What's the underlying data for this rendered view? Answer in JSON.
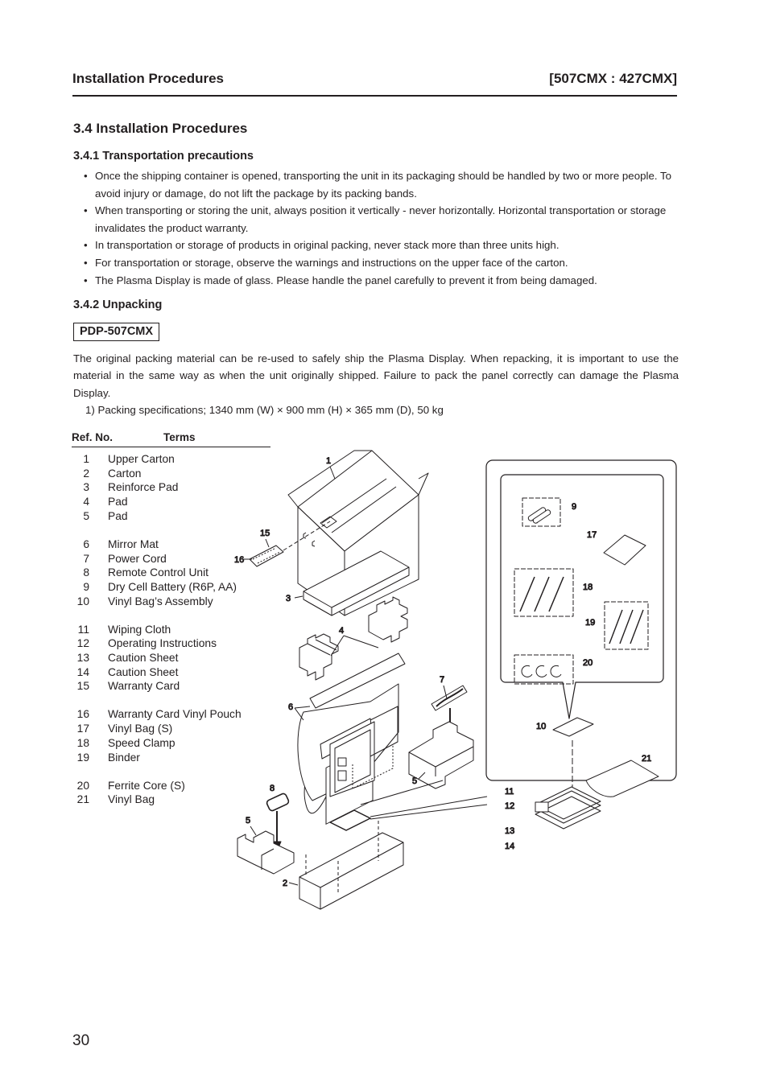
{
  "header": {
    "title": "Installation Procedures",
    "model": "[507CMX : 427CMX]"
  },
  "section": {
    "title": "3.4 Installation Procedures",
    "transportation": {
      "title": "3.4.1 Transportation precautions",
      "bullets": [
        "Once the shipping container is opened, transporting the unit in its packaging should be handled by two or more people. To avoid injury or damage, do not lift the package by its packing bands.",
        "When transporting or storing the unit, always position it vertically - never horizontally. Horizontal transportation or storage invalidates the product warranty.",
        "In transportation or storage of products in original packing, never stack more than three units high.",
        "For transportation or storage, observe the warnings and instructions on the upper face of the carton.",
        "The Plasma Display is made of glass. Please handle the panel carefully to prevent it from being damaged."
      ]
    },
    "unpacking": {
      "title": "3.4.2 Unpacking",
      "model_label": "PDP-507CMX",
      "paragraph": "The original packing material can be re-used to safely ship the Plasma Display. When repacking, it is important to use the material in the same way as when the unit originally shipped. Failure to pack the panel correctly can damage the Plasma Display.",
      "spec": "1)  Packing specifications; 1340 mm (W) × 900 mm (H) × 365 mm (D), 50 kg",
      "table": {
        "col_ref": "Ref. No.",
        "col_terms": "Terms",
        "rows": [
          {
            "ref": "1",
            "term": "Upper Carton"
          },
          {
            "ref": "2",
            "term": "Carton"
          },
          {
            "ref": "3",
            "term": "Reinforce Pad"
          },
          {
            "ref": "4",
            "term": "Pad"
          },
          {
            "ref": "5",
            "term": "Pad"
          },
          {
            "ref": "6",
            "term": "Mirror Mat"
          },
          {
            "ref": "7",
            "term": "Power Cord"
          },
          {
            "ref": "8",
            "term": "Remote Control Unit"
          },
          {
            "ref": "9",
            "term": "Dry Cell Battery (R6P, AA)"
          },
          {
            "ref": "10",
            "term": "Vinyl Bag’s Assembly"
          },
          {
            "ref": "11",
            "term": "Wiping Cloth"
          },
          {
            "ref": "12",
            "term": "Operating Instructions"
          },
          {
            "ref": "13",
            "term": "Caution Sheet"
          },
          {
            "ref": "14",
            "term": "Caution Sheet"
          },
          {
            "ref": "15",
            "term": "Warranty Card"
          },
          {
            "ref": "16",
            "term": "Warranty Card Vinyl Pouch"
          },
          {
            "ref": "17",
            "term": "Vinyl Bag (S)"
          },
          {
            "ref": "18",
            "term": "Speed Clamp"
          },
          {
            "ref": "19",
            "term": "Binder"
          },
          {
            "ref": "20",
            "term": "Ferrite Core (S)"
          },
          {
            "ref": "21",
            "term": "Vinyl Bag"
          }
        ]
      }
    }
  },
  "diagram": {
    "callouts": {
      "c1": "1",
      "c2": "2",
      "c3": "3",
      "c4": "4",
      "c5a": "5",
      "c5b": "5",
      "c6": "6",
      "c7": "7",
      "c8": "8",
      "c9": "9",
      "c10": "10",
      "c11": "11",
      "c12": "12",
      "c13": "13",
      "c14": "14",
      "c15": "15",
      "c16": "16",
      "c17": "17",
      "c18": "18",
      "c19": "19",
      "c20": "20",
      "c21": "21"
    }
  },
  "page_number": "30"
}
